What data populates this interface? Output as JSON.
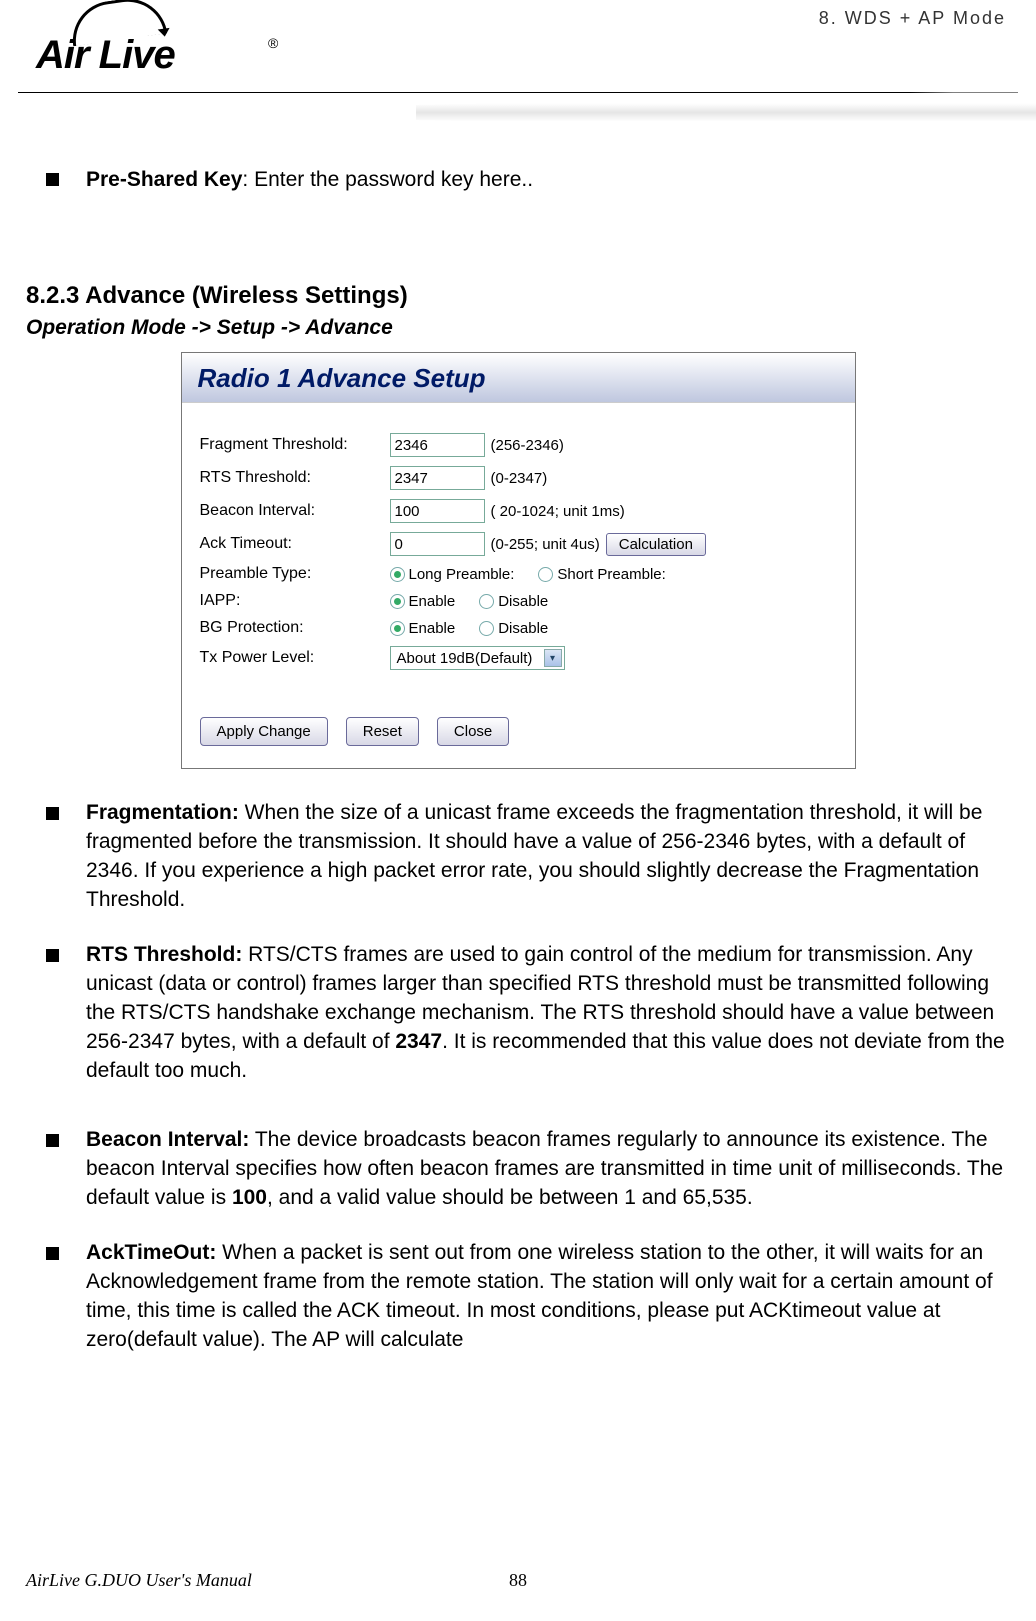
{
  "header": {
    "top_right": "8.  WDS  +  AP  Mode",
    "logo_text": "Air Live",
    "logo_reg": "®"
  },
  "pre_bullet": {
    "label": "Pre-Shared Key",
    "text": ":    Enter the password key here.."
  },
  "section": {
    "heading": "8.2.3 Advance (Wireless Settings)",
    "breadcrumb": "Operation Mode -> Setup -> Advance"
  },
  "screenshot": {
    "title": "Radio 1 Advance Setup",
    "rows": {
      "frag": {
        "label": "Fragment Threshold:",
        "value": "2346",
        "hint": "(256-2346)"
      },
      "rts": {
        "label": "RTS Threshold:",
        "value": "2347",
        "hint": "(0-2347)"
      },
      "beacon": {
        "label": "Beacon Interval:",
        "value": "100",
        "hint": "( 20-1024; unit 1ms)"
      },
      "ack": {
        "label": "Ack Timeout:",
        "value": "0",
        "hint": "(0-255; unit 4us)",
        "button": "Calculation"
      },
      "preamble": {
        "label": "Preamble Type:",
        "opt1": "Long Preamble:",
        "opt2": "Short Preamble:"
      },
      "iapp": {
        "label": "IAPP:",
        "opt1": "Enable",
        "opt2": "Disable"
      },
      "bg": {
        "label": "BG Protection:",
        "opt1": "Enable",
        "opt2": "Disable"
      },
      "txpower": {
        "label": "Tx Power Level:",
        "value": "About 19dB(Default)"
      }
    },
    "buttons": {
      "apply": "Apply Change",
      "reset": "Reset",
      "close": "Close"
    }
  },
  "descriptions": {
    "frag": {
      "label": "Fragmentation:",
      "text": " When the size of a unicast frame exceeds the fragmentation threshold, it will be fragmented before the transmission. It should have a value of 256-2346 bytes, with a default of 2346.    If you experience a high packet error rate, you should slightly decrease the Fragmentation Threshold."
    },
    "rts": {
      "label": "RTS Threshold:",
      "text_before": " RTS/CTS frames are used to gain control of the medium for transmission. Any unicast (data or control) frames larger than specified RTS threshold must be transmitted following the RTS/CTS handshake exchange mechanism. The RTS threshold should have a value between 256-2347 bytes, with a default of ",
      "bold": "2347",
      "text_after": ". It is recommended that this value does not deviate from the default too much."
    },
    "beacon": {
      "label": "Beacon Interval:",
      "text_before": " The device broadcasts beacon frames regularly to announce its existence. The beacon Interval specifies how often beacon frames are transmitted in time unit of milliseconds. The default value is ",
      "bold": "100",
      "text_after": ", and a valid value should be between 1 and 65,535."
    },
    "ack": {
      "label": "AckTimeOut:",
      "text": "   When a packet is sent out from one wireless station to the other, it will waits for an Acknowledgement frame from the remote station.    The station will only wait for a certain amount of time, this time is called the ACK timeout.    In most conditions, please put ACKtimeout value at zero(default value).    The AP will calculate"
    }
  },
  "footer": {
    "left": "AirLive G.DUO User's Manual",
    "center": "88"
  }
}
